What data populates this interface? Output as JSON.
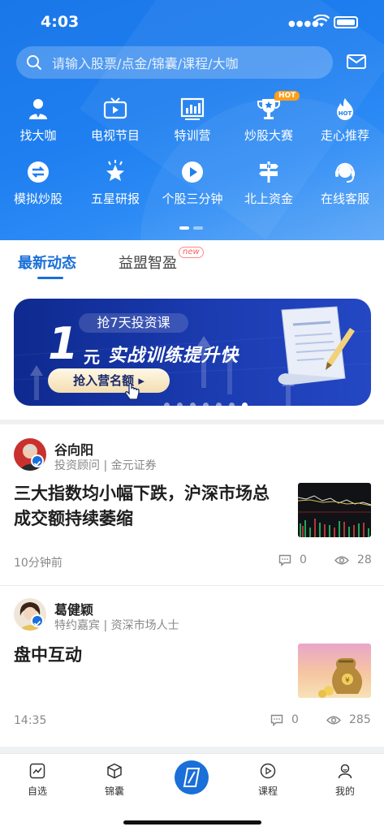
{
  "status_bar": {
    "time": "4:03"
  },
  "search": {
    "placeholder": "请输入股票/点金/锦囊/课程/大咖"
  },
  "grid": {
    "row1": [
      {
        "label": "找大咖",
        "icon": "expert-icon"
      },
      {
        "label": "电视节目",
        "icon": "tv-icon"
      },
      {
        "label": "特训营",
        "icon": "chart-board-icon"
      },
      {
        "label": "炒股大赛",
        "icon": "trophy-icon",
        "badge": "HOT"
      },
      {
        "label": "走心推荐",
        "icon": "flame-icon"
      }
    ],
    "row2": [
      {
        "label": "模拟炒股",
        "icon": "simulate-icon"
      },
      {
        "label": "五星研报",
        "icon": "star-icon"
      },
      {
        "label": "个股三分钟",
        "icon": "play-icon"
      },
      {
        "label": "北上资金",
        "icon": "signpost-icon"
      },
      {
        "label": "在线客服",
        "icon": "headset-icon"
      }
    ]
  },
  "tabs": {
    "active": "最新动态",
    "other": "益盟智盈",
    "new_badge": "new"
  },
  "banner": {
    "pill": "抢7天投资课",
    "number": "1",
    "unit": "元",
    "slogan": "实战训练提升快",
    "cta": "抢入营名额",
    "page_index": 7,
    "page_count": 7
  },
  "feed": [
    {
      "author": "谷向阳",
      "role": "投资顾问 | 金元证券",
      "title": "三大指数均小幅下跌，沪深市场总成交额持续萎缩",
      "time": "10分钟前",
      "comments": "0",
      "views": "28"
    },
    {
      "author": "葛健颖",
      "role": "特约嘉宾 | 资深市场人士",
      "title": "盘中互动",
      "time": "14:35",
      "comments": "0",
      "views": "285"
    }
  ],
  "tabbar": [
    {
      "label": "自选",
      "icon": "chart-icon"
    },
    {
      "label": "锦囊",
      "icon": "box-icon"
    },
    {
      "label": "",
      "icon": "center-logo-icon"
    },
    {
      "label": "课程",
      "icon": "play-circle-icon"
    },
    {
      "label": "我的",
      "icon": "user-icon"
    }
  ],
  "colors": {
    "brand": "#1a6fd8",
    "header": "#1f7ff0",
    "badge_hot": "#ff9f1a"
  }
}
